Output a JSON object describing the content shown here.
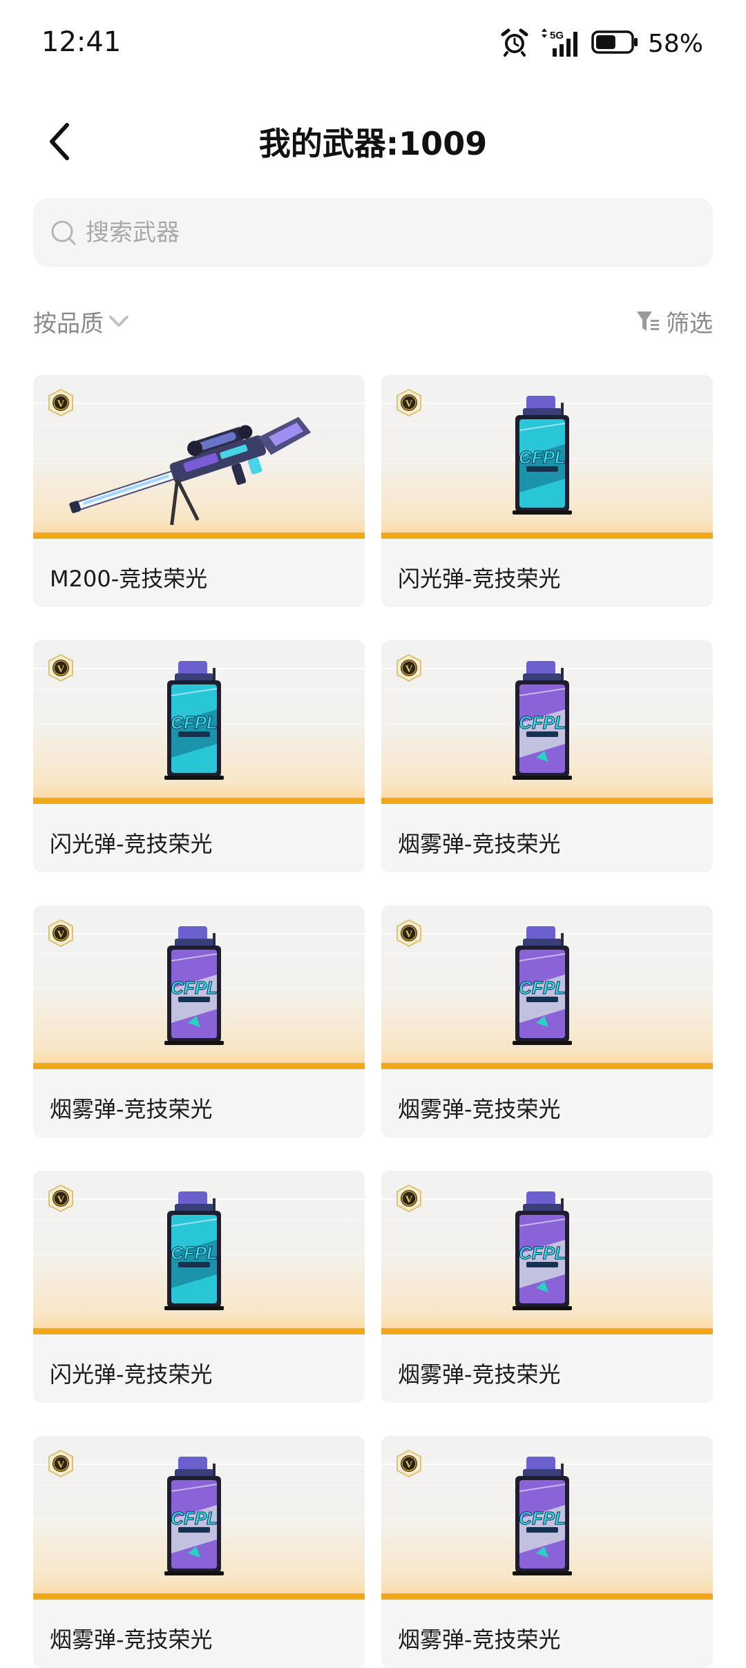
{
  "status_bar": {
    "time": "12:41",
    "network": "5G",
    "battery_percent": "58%",
    "battery_level": 0.58
  },
  "header": {
    "title": "我的武器:1009"
  },
  "search": {
    "placeholder": "搜索武器"
  },
  "toolbar": {
    "sort_label": "按品质",
    "filter_label": "筛选"
  },
  "colors": {
    "accent_orange": "#f2a81c",
    "badge_gold": "#c9a227",
    "muted_text": "#8a8a8a"
  },
  "weapons": [
    {
      "name": "M200-竞技荣光",
      "type": "sniper-rifle",
      "badge": "V"
    },
    {
      "name": "闪光弹-竞技荣光",
      "type": "flashbang",
      "badge": "V"
    },
    {
      "name": "闪光弹-竞技荣光",
      "type": "flashbang",
      "badge": "V"
    },
    {
      "name": "烟雾弹-竞技荣光",
      "type": "smoke-grenade",
      "badge": "V"
    },
    {
      "name": "烟雾弹-竞技荣光",
      "type": "smoke-grenade",
      "badge": "V"
    },
    {
      "name": "烟雾弹-竞技荣光",
      "type": "smoke-grenade",
      "badge": "V"
    },
    {
      "name": "闪光弹-竞技荣光",
      "type": "flashbang",
      "badge": "V"
    },
    {
      "name": "烟雾弹-竞技荣光",
      "type": "smoke-grenade",
      "badge": "V"
    },
    {
      "name": "烟雾弹-竞技荣光",
      "type": "smoke-grenade",
      "badge": "V"
    },
    {
      "name": "烟雾弹-竞技荣光",
      "type": "smoke-grenade",
      "badge": "V"
    }
  ]
}
